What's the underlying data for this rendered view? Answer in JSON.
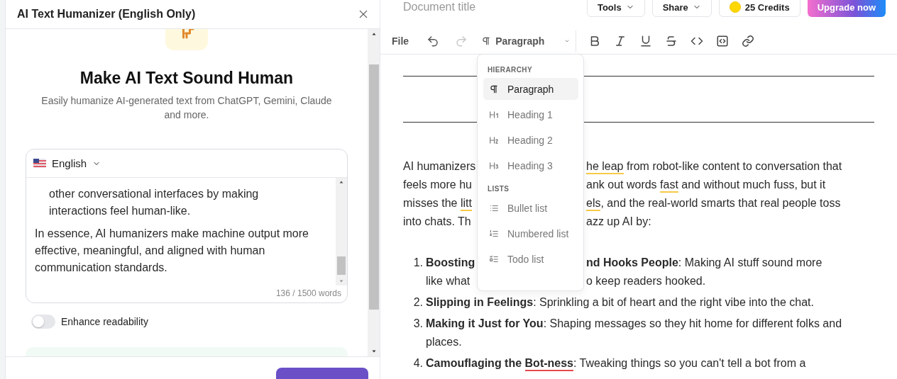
{
  "panel": {
    "title": "AI Text Humanizer (English Only)",
    "heading": "Make AI Text Sound Human",
    "subtitle": "Easily humanize AI-generated text from ChatGPT, Gemini, Claude and more.",
    "language": "English",
    "input": {
      "blocks": [
        {
          "kind": "indented",
          "text": "other conversational interfaces by making interactions feel human-like."
        },
        {
          "kind": "paragraph",
          "text": "In essence, AI humanizers make machine output more effective, meaningful, and aligned with human communication standards."
        }
      ],
      "count": "136 / 1500 words"
    },
    "toggle": {
      "label": "Enhance readability",
      "on": false
    }
  },
  "topbar": {
    "title_placeholder": "Document title",
    "buttons": [
      {
        "label": "Tools",
        "kind": "menu"
      },
      {
        "label": "Share",
        "kind": "menu"
      },
      {
        "label": "25 Credits",
        "kind": "credits"
      },
      {
        "label": "Upgrade now",
        "kind": "upgrade"
      }
    ]
  },
  "toolbar": {
    "file": "File",
    "undo": {
      "disabled": false
    },
    "redo": {
      "disabled": true
    },
    "block_type": "Paragraph"
  },
  "menu": {
    "sections": [
      {
        "title": "HIERARCHY",
        "items": [
          {
            "label": "Paragraph",
            "selected": true
          },
          {
            "label": "Heading 1",
            "selected": false
          },
          {
            "label": "Heading 2",
            "selected": false
          },
          {
            "label": "Heading 3",
            "selected": false
          }
        ]
      },
      {
        "title": "LISTS",
        "items": [
          {
            "label": "Bullet list",
            "selected": false
          },
          {
            "label": "Numbered list",
            "selected": false
          },
          {
            "label": "Todo list",
            "selected": false
          }
        ]
      }
    ]
  },
  "document": {
    "paragraph": [
      {
        "left": [
          {
            "text": "AI humanizers"
          }
        ],
        "right": [
          {
            "text": "he leap",
            "color": "#f7c948"
          },
          {
            "text": " from robot-like content to conversation that"
          }
        ]
      },
      {
        "left": [
          {
            "text": "feels more hu"
          }
        ],
        "right": [
          {
            "text": "ank out words "
          },
          {
            "text": "fast",
            "color": "#f7c948"
          },
          {
            "text": " and without much fuss, but it"
          }
        ]
      },
      {
        "left": [
          {
            "text": "misses the "
          },
          {
            "text": "litt",
            "color": "#f7c948"
          }
        ],
        "right": [
          {
            "text": "els",
            "color": "#f7c948"
          },
          {
            "text": ", and the real-world smarts that real people toss"
          }
        ]
      },
      {
        "left": [
          {
            "text": "into chats. Th"
          }
        ],
        "right": [
          {
            "text": "azz up AI by:"
          }
        ]
      }
    ],
    "list": [
      {
        "number": "1.",
        "lines": [
          {
            "left": [
              {
                "text": "**Boosting**"
              }
            ],
            "right": [
              {
                "text": "**nd Hooks People**: Making AI stuff sound more"
              }
            ]
          },
          {
            "left": [
              {
                "text": "like what"
              }
            ],
            "right": [
              {
                "text": "o keep readers hooked."
              }
            ]
          }
        ]
      },
      {
        "number": "2.",
        "lines": [
          {
            "full": [
              {
                "text": "**Slipping in Feelings**: Sprinkling a bit of heart and the right vibe into the chat."
              }
            ]
          }
        ]
      },
      {
        "number": "3.",
        "lines": [
          {
            "full": [
              {
                "text": "**Making it Just for You**: Shaping messages so they hit home for different folks and places."
              }
            ]
          }
        ]
      },
      {
        "number": "4.",
        "lines": [
          {
            "full": [
              {
                "text": "**Camouflaging the** "
              },
              {
                "text": "**Bot-ness**",
                "color": "#e5484d"
              },
              {
                "text": ": Tweaking things so you can't tell a bot from a"
              }
            ]
          }
        ]
      }
    ]
  }
}
